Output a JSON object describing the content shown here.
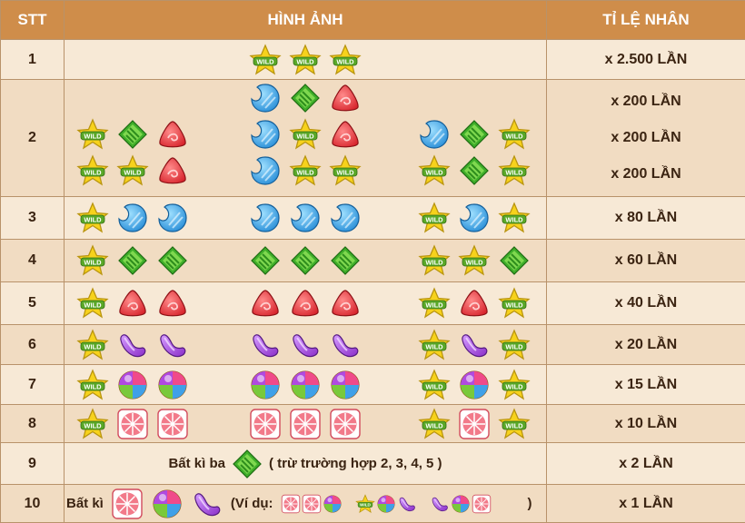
{
  "header": {
    "stt": "STT",
    "image": "HÌNH ẢNH",
    "ratio": "TỈ LỆ NHÂN"
  },
  "rows": [
    {
      "stt": "1",
      "mults": [
        "x 2.500 LẦN"
      ]
    },
    {
      "stt": "2",
      "mults": [
        "x 200 LẦN",
        "x 200 LẦN",
        "x 200 LẦN"
      ]
    },
    {
      "stt": "3",
      "mults": [
        "x 80 LẦN"
      ]
    },
    {
      "stt": "4",
      "mults": [
        "x 60 LẦN"
      ]
    },
    {
      "stt": "5",
      "mults": [
        "x 40 LẦN"
      ]
    },
    {
      "stt": "6",
      "mults": [
        "x 20 LẦN"
      ]
    },
    {
      "stt": "7",
      "mults": [
        "x 15 LẦN"
      ]
    },
    {
      "stt": "8",
      "mults": [
        "x 10 LẦN"
      ]
    },
    {
      "stt": "9",
      "mults": [
        "x 2 LẦN"
      ]
    },
    {
      "stt": "10",
      "mults": [
        "x 1 LẦN"
      ]
    }
  ],
  "row9": {
    "prefix": "Bất kì ba",
    "suffix": "( trừ trường hợp 2, 3, 4, 5 )"
  },
  "row10": {
    "prefix": "Bất kì",
    "example_open": "(Ví dụ:",
    "example_close": ")"
  },
  "wild_text": "WILD",
  "colors": {
    "header": "#cf8d4a",
    "wild": "#f7d21c",
    "blue": "#2a8fd8",
    "green": "#3fae2a",
    "red": "#d8262e",
    "purple": "#8b2fc9",
    "grapefruit": "#f27a8a"
  }
}
